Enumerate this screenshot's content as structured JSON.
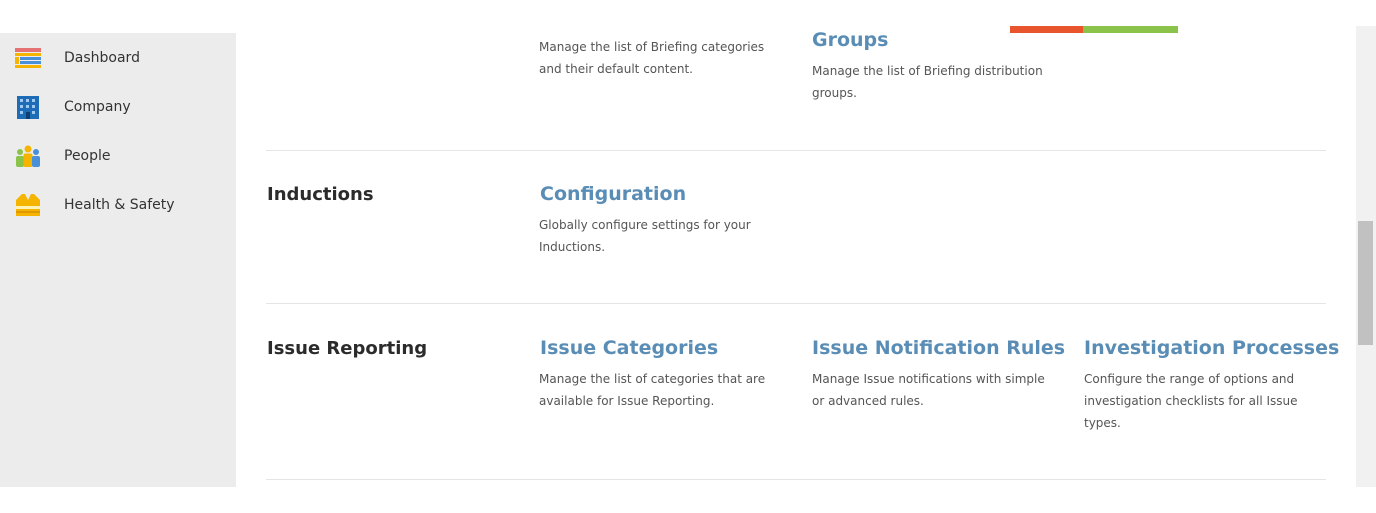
{
  "colors": {
    "accent_red": "#e8542b",
    "accent_green": "#8bc34a",
    "link_blue": "#5a8db5",
    "sidebar_bg": "#ececec"
  },
  "sidebar": {
    "items": [
      {
        "label": "Dashboard",
        "icon": "dashboard-icon"
      },
      {
        "label": "Company",
        "icon": "company-building-icon"
      },
      {
        "label": "People",
        "icon": "people-icon"
      },
      {
        "label": "Health & Safety",
        "icon": "safety-vest-icon"
      }
    ]
  },
  "sections": {
    "briefings": {
      "cards": [
        {
          "title": "",
          "desc": "Manage the list of Briefing categories and their default content."
        },
        {
          "title": "Groups",
          "desc": "Manage the list of Briefing distribution groups."
        }
      ]
    },
    "inductions": {
      "title": "Inductions",
      "cards": [
        {
          "title": "Configuration",
          "desc": "Globally configure settings for your Inductions."
        }
      ]
    },
    "issue_reporting": {
      "title": "Issue Reporting",
      "cards": [
        {
          "title": "Issue Categories",
          "desc": "Manage the list of categories that are available for Issue Reporting."
        },
        {
          "title": "Issue Notification Rules",
          "desc": "Manage Issue notifications with simple or advanced rules."
        },
        {
          "title": "Investigation Processes",
          "desc": "Configure the range of options and investigation checklists for all Issue types."
        }
      ]
    }
  }
}
